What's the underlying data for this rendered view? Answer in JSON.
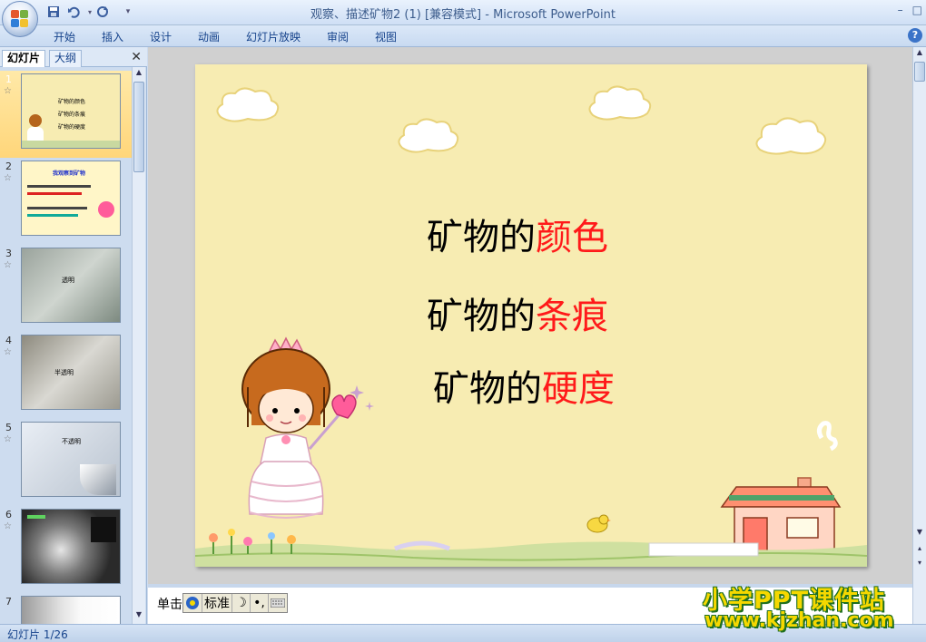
{
  "window": {
    "title": "观察、描述矿物2 (1) [兼容模式] - Microsoft PowerPoint",
    "buttons": {
      "minimize": "–",
      "restore": "□"
    }
  },
  "ribbon": {
    "tabs": [
      "开始",
      "插入",
      "设计",
      "动画",
      "幻灯片放映",
      "审阅",
      "视图"
    ],
    "help": "?"
  },
  "left_pane": {
    "tabs": {
      "slides": "幻灯片",
      "outline": "大纲"
    },
    "close": "✕",
    "thumbnails": [
      {
        "num": "1",
        "star": "☆",
        "lines": [
          "矿物的颜色",
          "矿物的条痕",
          "矿物的硬度"
        ]
      },
      {
        "num": "2",
        "star": "☆",
        "heading": "我观察到矿物"
      },
      {
        "num": "3",
        "star": "☆",
        "label": "透明"
      },
      {
        "num": "4",
        "star": "☆",
        "label": "半透明"
      },
      {
        "num": "5",
        "star": "☆",
        "label": "不透明"
      },
      {
        "num": "6",
        "star": "☆"
      },
      {
        "num": "7"
      }
    ]
  },
  "slide": {
    "lines": [
      {
        "black": "矿物的",
        "red": "颜色"
      },
      {
        "black": "矿物的",
        "red": "条痕"
      },
      {
        "black": "矿物的",
        "red": "硬度"
      }
    ]
  },
  "notes": {
    "text": "单击",
    "ime": {
      "mode": "标准"
    }
  },
  "status_bar": {
    "slide_counter": "幻灯片 1/26"
  },
  "watermark": {
    "line1": "小学PPT课件站",
    "line2": "www.kjzhan.com"
  },
  "colors": {
    "accent_red": "#ff1a1a",
    "slide_bg": "#f7ecb2",
    "ribbon_text": "#15428b"
  }
}
